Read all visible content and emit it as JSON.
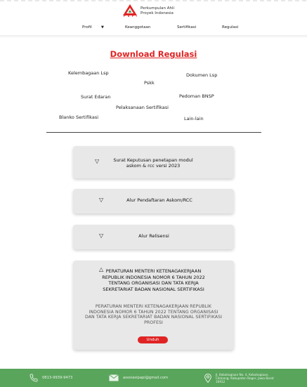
{
  "header": {
    "logo_line1": "Perkumpulan Ahli",
    "logo_line2": "Proyek Indonesia",
    "logo_acronym": "P A P I",
    "nav": [
      {
        "label": "Profil",
        "has_dropdown": true
      },
      {
        "label": "Keanggotaan"
      },
      {
        "label": "Sertifikasi"
      },
      {
        "label": "Regulasi"
      }
    ],
    "brand_color": "#e02424"
  },
  "page_title": "Download Regulasi",
  "categories": [
    "Kelembagaan Lsp",
    "Pskk",
    "Dokumen Lsp",
    "Surat Edaran",
    "Pedoman BNSP",
    "Pelaksanaan Sertifikasi",
    "Blanko Sertifikasi",
    "Lain-lain"
  ],
  "documents": [
    {
      "title": "Surat Keputusan penetapan modul askom & rcc versi 2023",
      "expanded": false,
      "icon": "triangle-down-icon"
    },
    {
      "title": "Alur Pendaftaran Askom/RCC",
      "expanded": false,
      "icon": "triangle-down-icon"
    },
    {
      "title": "Alur Relisensi",
      "expanded": false,
      "icon": "triangle-down-icon"
    },
    {
      "title": "PERATURAN MENTERI KETENAGAKERJAAN REPUBLIK INDONESIA NOMOR 6 TAHUN 2022 TENTANG ORGANISASI DAN TATA KERJA SEKRETARIAT BADAN NASIONAL SERTIFIKASI",
      "expanded": true,
      "icon": "triangle-up-icon",
      "description": "PERATURAN MENTERI KETENAGAKERJAAN REPUBLIK INDONESIA NOMOR 6 TAHUN 2022 TENTANG ORGANISASI DAN TATA KERJA SEKRETARIAT BADAN NASIONAL SERTIFIKASI PROFESI",
      "button_label": "Unduh"
    }
  ],
  "footer": {
    "phone": "0813-9939-9473",
    "email": "asosiasipapi@gmail.com",
    "address": "Jl. Kebahagiaan No. 4, Kebahagiaan, Cibinong, Kabupaten Bogor, Jawa Barat 16912",
    "background": "#5aa55c"
  }
}
